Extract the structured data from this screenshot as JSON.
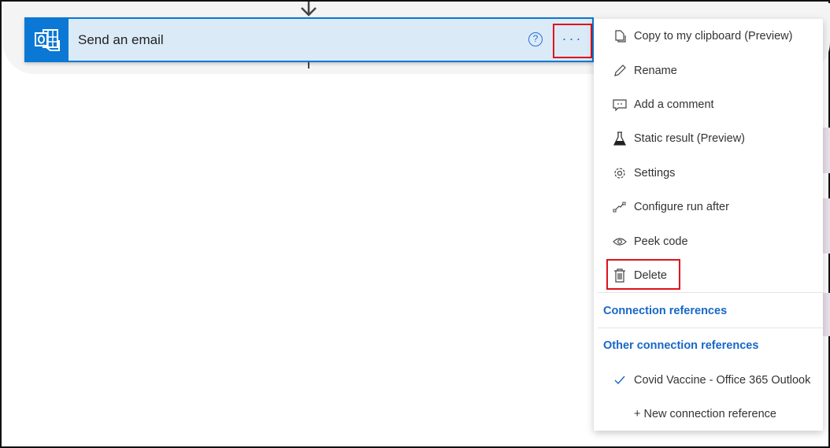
{
  "action_card": {
    "title": "Send an email",
    "help_symbol": "?",
    "more_symbol": "···"
  },
  "menu": {
    "items": [
      {
        "label": "Copy to my clipboard (Preview)",
        "icon": "copy-icon"
      },
      {
        "label": "Rename",
        "icon": "pencil-icon"
      },
      {
        "label": "Add a comment",
        "icon": "comment-icon"
      },
      {
        "label": "Static result (Preview)",
        "icon": "flask-icon"
      },
      {
        "label": "Settings",
        "icon": "gear-icon"
      },
      {
        "label": "Configure run after",
        "icon": "run-after-icon"
      },
      {
        "label": "Peek code",
        "icon": "eye-icon"
      },
      {
        "label": "Delete",
        "icon": "trash-icon"
      }
    ],
    "connection_references": "Connection references",
    "other_connection_references": "Other connection references",
    "selected_connection": "Covid Vaccine - Office 365 Outlook",
    "new_connection": "+ New connection reference"
  },
  "colors": {
    "accent": "#0a78d4",
    "highlight": "#e0101c",
    "link": "#1667c8"
  }
}
